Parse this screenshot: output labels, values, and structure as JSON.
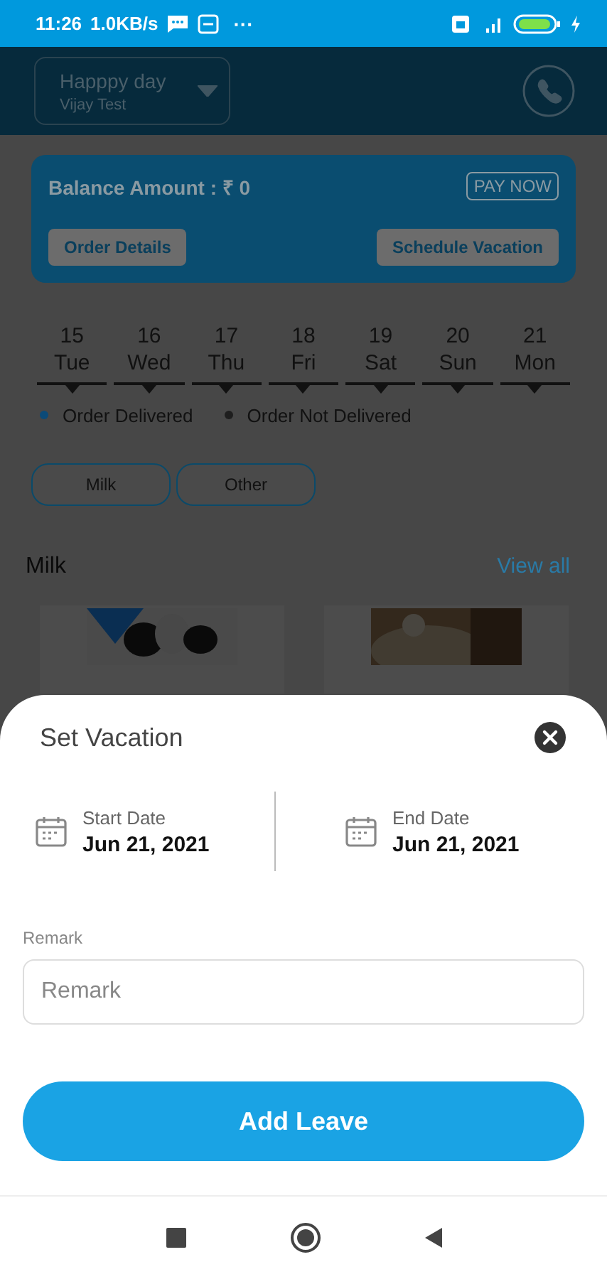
{
  "status_bar": {
    "time": "11:26",
    "speed": "1.0KB/s",
    "more": "···"
  },
  "header": {
    "title": "Happpy day",
    "subtitle": "Vijay Test"
  },
  "balance_card": {
    "label": "Balance Amount : ₹ 0",
    "pay_button": "PAY NOW",
    "buttons": [
      "Order Details",
      "Schedule Vacation"
    ]
  },
  "calendar": [
    {
      "day": "15",
      "weekday": "Tue"
    },
    {
      "day": "16",
      "weekday": "Wed"
    },
    {
      "day": "17",
      "weekday": "Thu"
    },
    {
      "day": "18",
      "weekday": "Fri"
    },
    {
      "day": "19",
      "weekday": "Sat"
    },
    {
      "day": "20",
      "weekday": "Sun"
    },
    {
      "day": "21",
      "weekday": "Mon"
    }
  ],
  "legend": [
    {
      "label": "Order Delivered",
      "color": "#0b4a78"
    },
    {
      "label": "Order Not Delivered",
      "color": "#1e1e1e"
    }
  ],
  "categories": [
    "Milk",
    "Other"
  ],
  "section": {
    "title": "Milk",
    "link": "View all"
  },
  "sheet": {
    "title": "Set Vacation",
    "dates": [
      {
        "label": "Start Date",
        "value": "Jun 21, 2021"
      },
      {
        "label": "End Date",
        "value": "Jun 21, 2021"
      }
    ],
    "remark_label": "Remark",
    "remark_placeholder": "Remark",
    "submit": "Add Leave"
  }
}
